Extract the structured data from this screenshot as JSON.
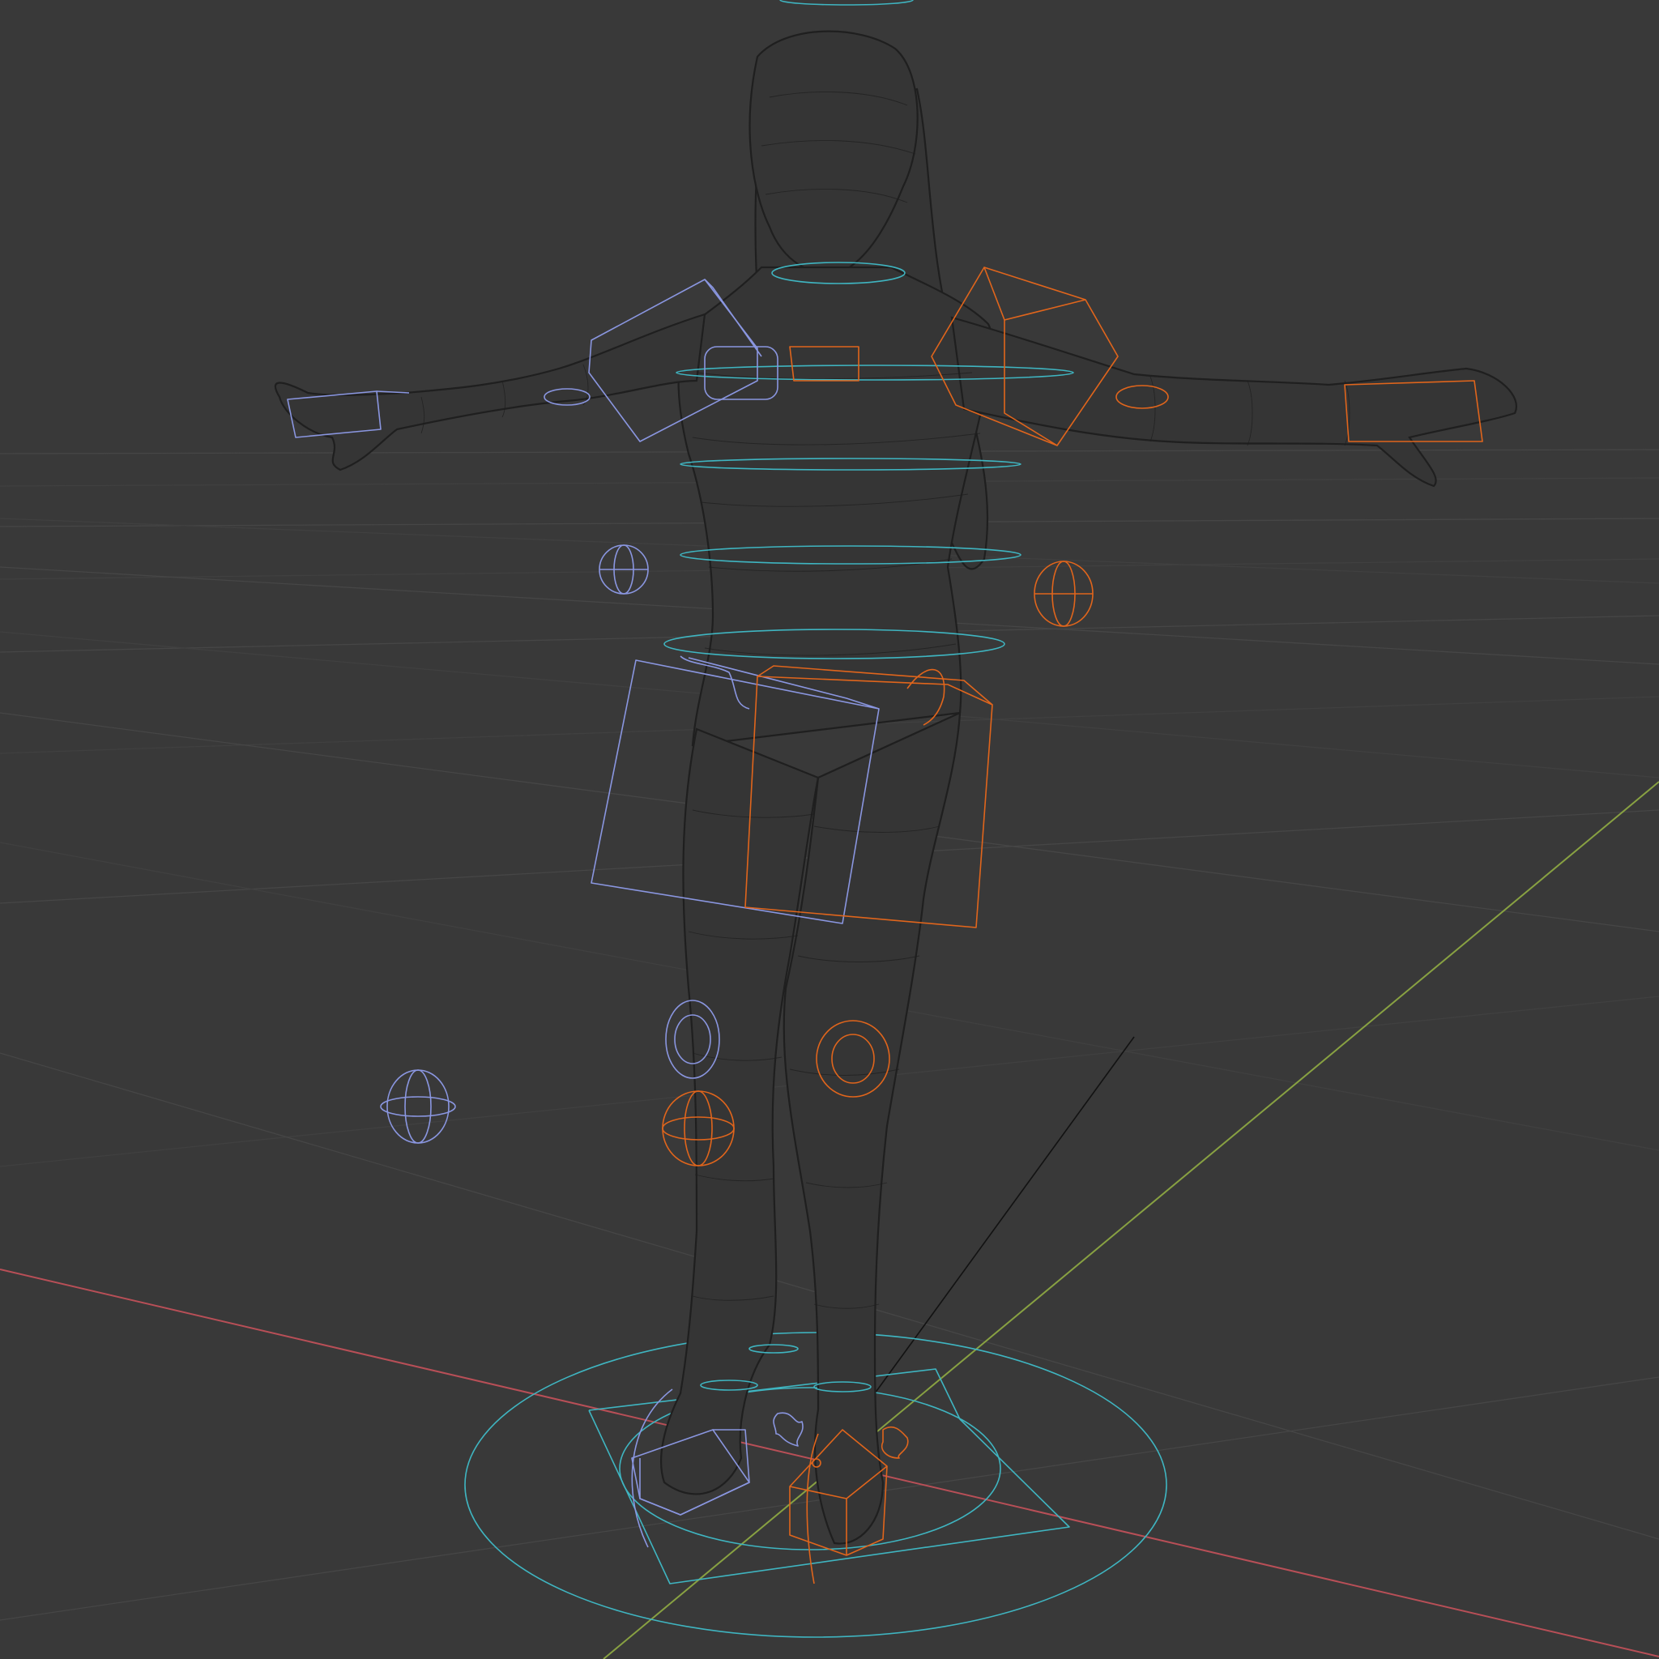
{
  "viewport": {
    "type": "3d-viewport",
    "shading": "wireframe",
    "view": "perspective",
    "object": "character-mesh",
    "rig": "armature-with-ik-controls"
  },
  "colors": {
    "background": "#393939",
    "grid_line": "#464646",
    "grid_line_faint": "#404040",
    "x_axis": "#b84f57",
    "y_axis": "#88a142",
    "mesh_wire": "#1f1f1f",
    "mesh_fill": "#343434",
    "control_left": "#8a96e0",
    "control_right": "#e0651c",
    "control_center": "#3fb5c1",
    "bone_line": "#121212"
  }
}
